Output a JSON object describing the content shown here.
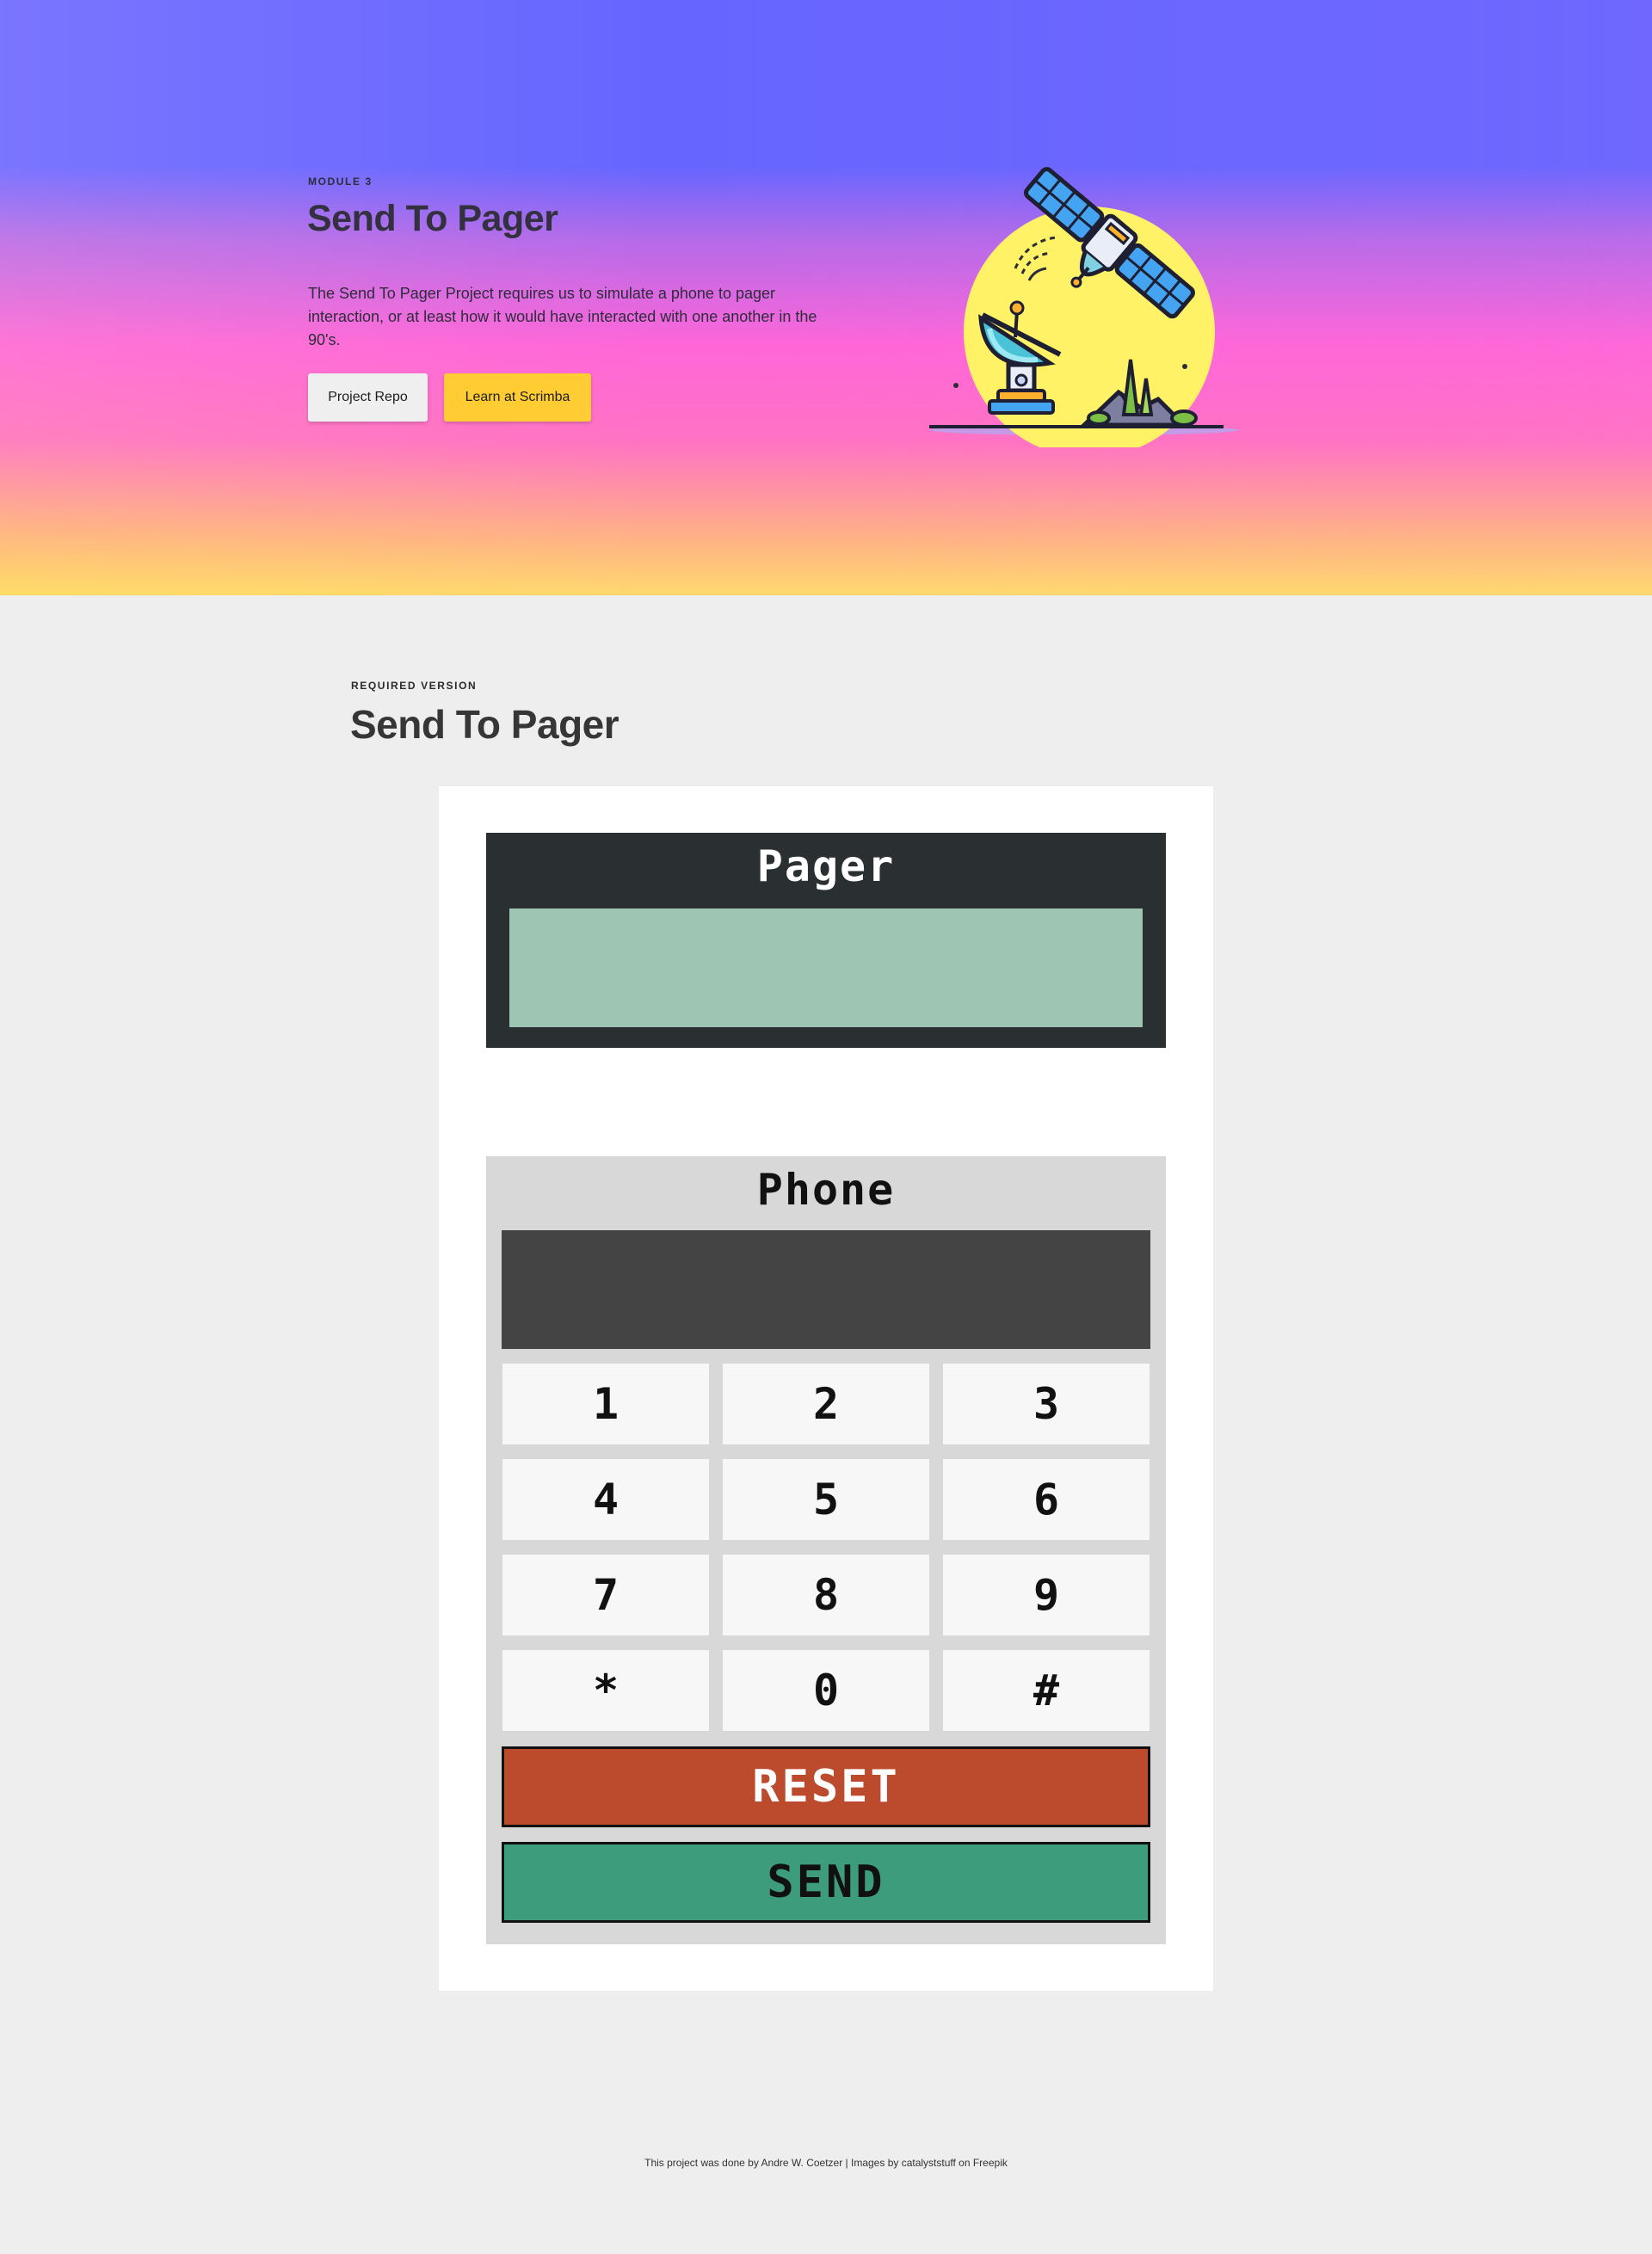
{
  "colors": {
    "hero_gradient_top": "#6666ff",
    "hero_gradient_mid": "#ff66d9",
    "hero_gradient_bottom": "#ffd86e",
    "page_background": "#eeeeee",
    "pager_body": "#2a2f31",
    "pager_screen": "#9ec5b3",
    "phone_body": "#d8d8d8",
    "phone_screen": "#444444",
    "reset_button": "#bc4a2c",
    "send_button": "#3d9c7b",
    "scrimba_button": "#ffcc33"
  },
  "hero": {
    "kicker": "MODULE 3",
    "title": "Send To Pager",
    "description": "The Send To Pager Project requires us to simulate a phone to pager interaction, or at least how it would have interacted with one another in the 90's.",
    "buttons": {
      "repo_label": "Project Repo",
      "scrimba_label": "Learn at Scrimba"
    },
    "illustration_icon": "satellite-dish-illustration"
  },
  "section": {
    "kicker": "REQUIRED VERSION",
    "title": "Send To Pager"
  },
  "pager": {
    "title": "Pager",
    "display_value": ""
  },
  "phone": {
    "title": "Phone",
    "display_value": "",
    "keys": [
      "1",
      "2",
      "3",
      "4",
      "5",
      "6",
      "7",
      "8",
      "9",
      "*",
      "0",
      "#"
    ],
    "reset_label": "RESET",
    "send_label": "SEND"
  },
  "footer": {
    "credit": "This project was done by Andre W. Coetzer | Images by catalyststuff on Freepik"
  }
}
